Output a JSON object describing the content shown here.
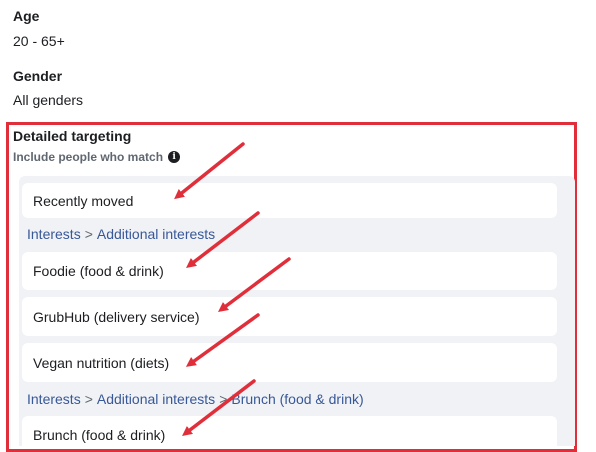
{
  "age": {
    "label": "Age",
    "value": "20 - 65+"
  },
  "gender": {
    "label": "Gender",
    "value": "All genders"
  },
  "detailed_targeting": {
    "label": "Detailed targeting",
    "sublabel": "Include people who match",
    "info_icon": "info-icon",
    "items": [
      {
        "type": "item",
        "label": "Recently moved"
      },
      {
        "type": "path",
        "parts": [
          "Interests",
          ">",
          "Additional interests"
        ]
      },
      {
        "type": "item",
        "label": "Foodie (food & drink)"
      },
      {
        "type": "item",
        "label": "GrubHub (delivery service)"
      },
      {
        "type": "item",
        "label": "Vegan nutrition (diets)"
      },
      {
        "type": "path",
        "parts": [
          "Interests",
          ">",
          "Additional interests",
          ">",
          "Brunch (food & drink)"
        ]
      },
      {
        "type": "item",
        "label": "Brunch (food & drink)"
      }
    ]
  },
  "colors": {
    "highlight_box": "#e02f3a",
    "annotation_arrow": "#e02f3a",
    "link": "#385898"
  }
}
